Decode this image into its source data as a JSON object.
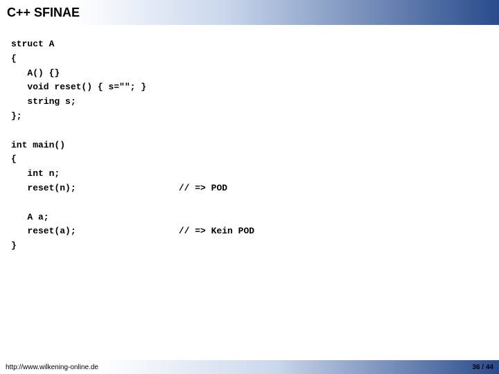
{
  "title": "C++ SFINAE",
  "code": "struct A\n{\n   A() {}\n   void reset() { s=\"\"; }\n   string s;\n};\n\nint main()\n{\n   int n;\n   reset(n);                   // => POD\n\n   A a;\n   reset(a);                   // => Kein POD\n}",
  "footer_url": "http://www.wilkening-online.de",
  "page_current": "36",
  "page_sep": " / ",
  "page_total": "44"
}
